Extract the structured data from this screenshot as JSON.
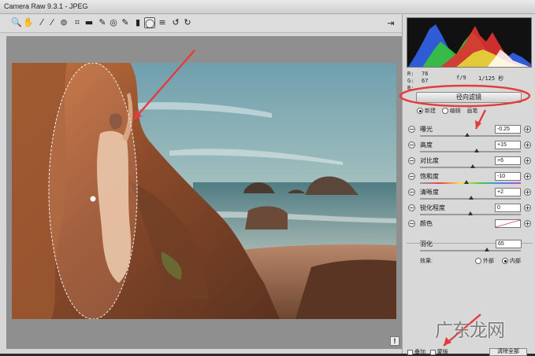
{
  "window": {
    "title": "Camera Raw 9.3.1  -  JPEG"
  },
  "toolbar": {
    "tools": [
      {
        "name": "zoom-tool",
        "icon": "🔍"
      },
      {
        "name": "hand-tool",
        "icon": "✋"
      },
      {
        "name": "white-balance-tool",
        "icon": "⁄"
      },
      {
        "name": "color-sampler-tool",
        "icon": "⁄"
      },
      {
        "name": "targeted-adjustment-tool",
        "icon": "⊚"
      },
      {
        "name": "crop-tool",
        "icon": "⌗"
      },
      {
        "name": "straighten-tool",
        "icon": "▬"
      },
      {
        "name": "spot-removal-tool",
        "icon": "✎"
      },
      {
        "name": "red-eye-tool",
        "icon": "◎"
      },
      {
        "name": "adjustment-brush-tool",
        "icon": "✎"
      },
      {
        "name": "graduated-filter-tool",
        "icon": "▮"
      },
      {
        "name": "radial-filter-tool",
        "icon": "◯"
      },
      {
        "name": "preferences-tool",
        "icon": "≡"
      },
      {
        "name": "rotate-left-tool",
        "icon": "↺"
      },
      {
        "name": "rotate-right-tool",
        "icon": "↻"
      }
    ],
    "export_icon": "⇥"
  },
  "histogram": {
    "r_label": "R:",
    "r_value": "76",
    "g_label": "G:",
    "g_value": "67",
    "b_label": "B:",
    "aperture": "f/9",
    "shutter": "1/125 秒"
  },
  "panel": {
    "mode_button": "径向滤镜",
    "mode_new": "新建",
    "mode_edit": "编辑",
    "mode_brush": "画笔",
    "sliders": [
      {
        "label": "曝光",
        "value": "-0.25",
        "pos": 0.47
      },
      {
        "label": "高度",
        "value": "+15",
        "pos": 0.56
      },
      {
        "label": "对比度",
        "value": "+6",
        "pos": 0.52
      },
      {
        "label": "饱和度",
        "value": "-10",
        "pos": 0.46
      },
      {
        "label": "清晰度",
        "value": "+2",
        "pos": 0.51
      },
      {
        "label": "锐化程度",
        "value": "0",
        "pos": 0.5
      }
    ],
    "color_label": "颜色",
    "feather_label": "羽化",
    "feather_value": "65",
    "effect_label": "效果:",
    "effect_outside": "外部",
    "effect_inside": "内部"
  },
  "bottom": {
    "overlay_label": "叠加",
    "mask_label": "蒙版",
    "clear_button": "清除全部"
  },
  "watermark": "广东龙网",
  "colors": {
    "annotation": "#e53b3b",
    "panel_bg": "#d8d8d8"
  }
}
